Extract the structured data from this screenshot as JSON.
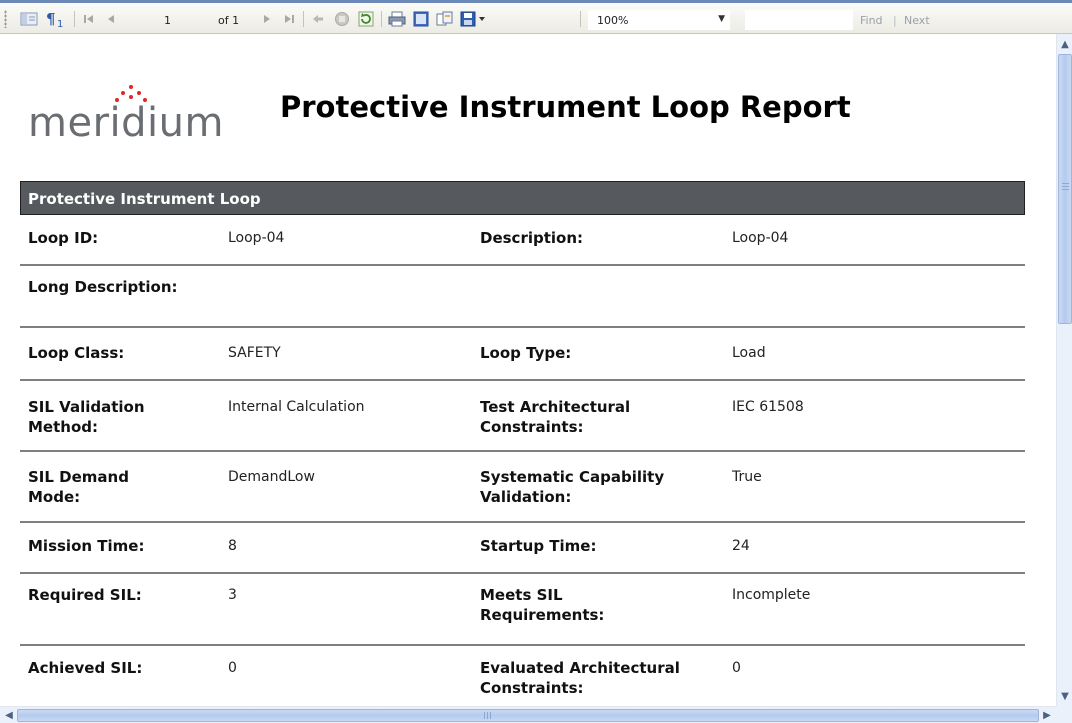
{
  "toolbar": {
    "icons": [
      "document-map-icon",
      "parameters-icon",
      "first-page-icon",
      "previous-page-icon",
      "next-page-icon",
      "last-page-icon",
      "back-icon",
      "stop-icon",
      "refresh-icon",
      "print-icon",
      "print-layout-icon",
      "page-setup-icon",
      "export-icon"
    ],
    "page_number": "1",
    "page_of": "of 1",
    "zoom": "100%",
    "find_text": "",
    "find_label": "Find",
    "find_separator": "|",
    "next_label": "Next"
  },
  "report": {
    "logo_text": "meridium",
    "logo_accent": "#e0262a",
    "title": "Protective Instrument Loop Report",
    "section_title": "Protective Instrument Loop",
    "rows": [
      {
        "label1": "Loop ID:",
        "value1": "Loop-04",
        "label2": "Description:",
        "value2": "Loop-04"
      },
      {
        "label1": "Long Description:",
        "value1": "",
        "label2": "",
        "value2": ""
      },
      {
        "label1": "Loop Class:",
        "value1": "SAFETY",
        "label2": "Loop Type:",
        "value2": "Load"
      },
      {
        "label1": "SIL Validation Method:",
        "value1": "Internal Calculation",
        "label2": "Test Architectural Constraints:",
        "value2": "IEC 61508"
      },
      {
        "label1": "SIL Demand Mode:",
        "value1": "DemandLow",
        "label2": "Systematic Capability Validation:",
        "value2": "True"
      },
      {
        "label1": "Mission Time:",
        "value1": "8",
        "label2": "Startup Time:",
        "value2": "24"
      },
      {
        "label1": "Required SIL:",
        "value1": "3",
        "label2": "Meets SIL Requirements:",
        "value2": "Incomplete"
      },
      {
        "label1": "Achieved SIL:",
        "value1": "0",
        "label2": "Evaluated Architectural Constraints:",
        "value2": "0"
      }
    ]
  },
  "colors": {
    "toolbar_border": "#6d89b8",
    "section_header_bg": "#565a5e",
    "row_divider": "#7f7f7f",
    "scrollbar_thumb": "#b4cbef"
  }
}
